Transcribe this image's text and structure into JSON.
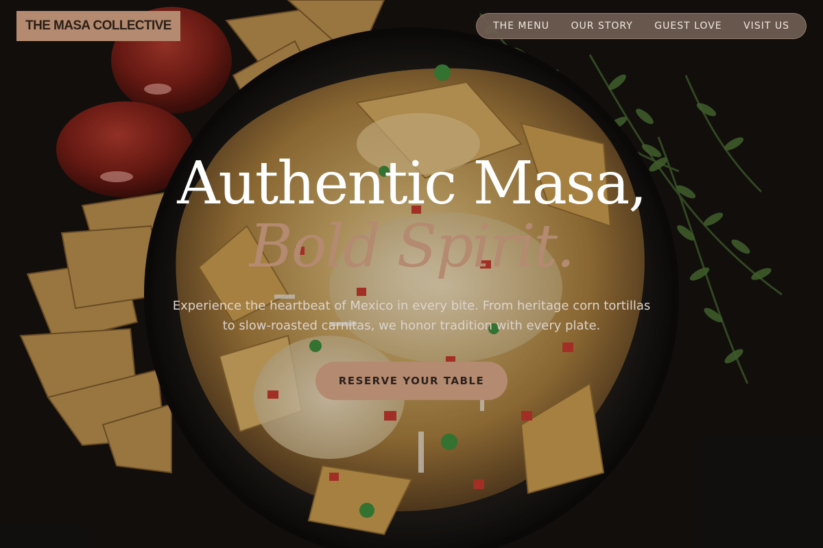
{
  "brand": {
    "name": "THE MASA COLLECTIVE"
  },
  "nav": {
    "items": [
      {
        "label": "THE MENU"
      },
      {
        "label": "OUR STORY"
      },
      {
        "label": "GUEST LOVE"
      },
      {
        "label": "VISIT US"
      }
    ]
  },
  "hero": {
    "title": "Authentic Masa,",
    "subtitle": "Bold Spirit.",
    "description": "Experience the heartbeat of Mexico in every bite. From heritage corn tortillas to slow-roasted carnitas, we honor tradition with every plate.",
    "cta_label": "RESERVE YOUR TABLE"
  },
  "colors": {
    "accent": "#b48a70",
    "background": "#14110d",
    "nav_pill": "#6e5c52",
    "text_light": "#ffffff",
    "text_muted": "#ddd3cc"
  },
  "icons": {
    "background_image": "nachos-plate-photo"
  }
}
